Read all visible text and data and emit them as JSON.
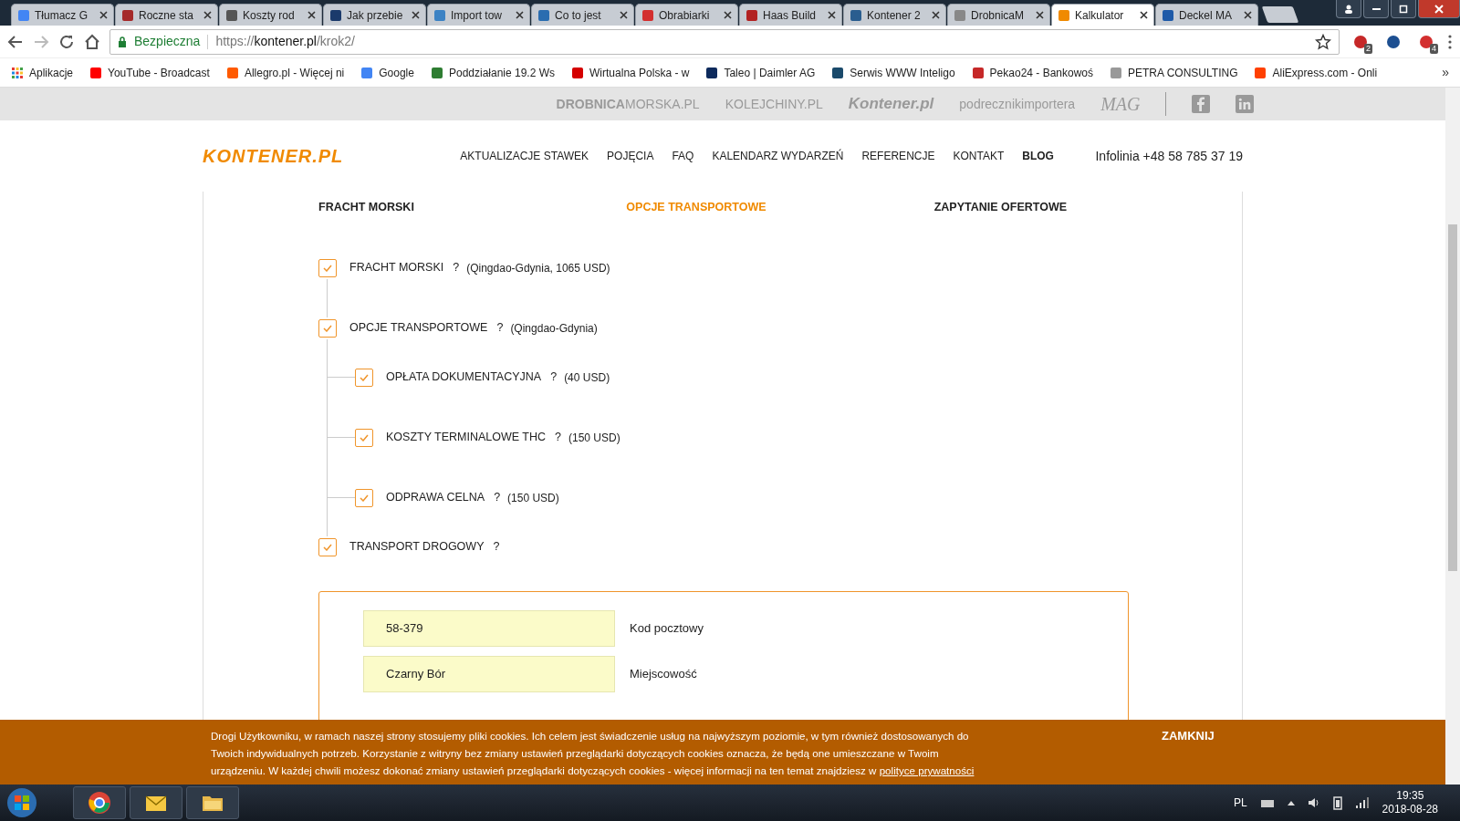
{
  "browser": {
    "tabs": [
      {
        "title": "Tłumacz G",
        "selected": false
      },
      {
        "title": "Roczne sta",
        "selected": false
      },
      {
        "title": "Koszty rod",
        "selected": false
      },
      {
        "title": "Jak przebie",
        "selected": false
      },
      {
        "title": "Import tow",
        "selected": false
      },
      {
        "title": "Co to jest",
        "selected": false
      },
      {
        "title": "Obrabiarki",
        "selected": false
      },
      {
        "title": "Haas Build",
        "selected": false
      },
      {
        "title": "Kontener 2",
        "selected": false
      },
      {
        "title": "DrobnicaM",
        "selected": false
      },
      {
        "title": "Kalkulator",
        "selected": true
      },
      {
        "title": "Deckel MA",
        "selected": false
      }
    ],
    "address": {
      "security": "Bezpieczna",
      "scheme": "https://",
      "host": "kontener.pl",
      "path": "/krok2/"
    },
    "extension_badges": [
      "2",
      "4"
    ],
    "bookmarks": [
      "Aplikacje",
      "YouTube - Broadcast",
      "Allegro.pl - Więcej ni",
      "Google",
      "Poddziałanie 19.2 Ws",
      "Wirtualna Polska - w",
      "Taleo | Daimler AG",
      "Serwis WWW Inteligo",
      "Pekao24 - Bankowoś",
      "PETRA CONSULTING",
      "AliExpress.com - Onli"
    ],
    "bookmarks_more": "»"
  },
  "partner_bar": {
    "logos": [
      "**DROBNICA**MORSKA.PL",
      "KOLEJCHINY.PL",
      "Kontener.pl",
      "podrecznikimportera",
      "MAG"
    ]
  },
  "header": {
    "logo": "KONTENER.PL",
    "nav": [
      {
        "label": "AKTUALIZACJE STAWEK",
        "bold": false
      },
      {
        "label": "POJĘCIA",
        "bold": false
      },
      {
        "label": "FAQ",
        "bold": false
      },
      {
        "label": "KALENDARZ WYDARZEŃ",
        "bold": false
      },
      {
        "label": "REFERENCJE",
        "bold": false
      },
      {
        "label": "KONTAKT",
        "bold": false
      },
      {
        "label": "BLOG",
        "bold": true
      }
    ],
    "hotline": "Infolinia +48 58 785 37 19"
  },
  "steps": [
    {
      "label": "FRACHT MORSKI",
      "selected": false
    },
    {
      "label": "OPCJE TRANSPORTOWE",
      "selected": true
    },
    {
      "label": "ZAPYTANIE OFERTOWE",
      "selected": false
    }
  ],
  "options": [
    {
      "label": "FRACHT MORSKI",
      "help": "?",
      "note": "(Qingdao-Gdynia, 1065 USD)",
      "checked": true
    },
    {
      "label": "OPCJE TRANSPORTOWE",
      "help": "?",
      "note": "(Qingdao-Gdynia)",
      "checked": true,
      "children": [
        {
          "label": "OPŁATA DOKUMENTACYJNA",
          "help": "?",
          "note": "(40 USD)",
          "checked": true
        },
        {
          "label": "KOSZTY TERMINALOWE THC",
          "help": "?",
          "note": "(150 USD)",
          "checked": true
        },
        {
          "label": "ODPRAWA CELNA",
          "help": "?",
          "note": "(150 USD)",
          "checked": true
        }
      ]
    },
    {
      "label": "TRANSPORT DROGOWY",
      "help": "?",
      "checked": true
    }
  ],
  "road_form": {
    "fields": [
      {
        "value": "58-379",
        "label": "Kod pocztowy"
      },
      {
        "value": "Czarny Bór",
        "label": "Miejscowość"
      }
    ]
  },
  "cookie_bar": {
    "text": "Drogi Użytkowniku, w ramach naszej strony stosujemy pliki cookies. Ich celem jest świadczenie usług na najwyższym poziomie, w tym również dostosowanych do Twoich indywidualnych potrzeb. Korzystanie z witryny bez zmiany ustawień przeglądarki dotyczących cookies oznacza, że będą one umieszczane w Twoim urządzeniu. W każdej chwili możesz dokonać zmiany ustawień przeglądarki dotyczących cookies - więcej informacji na ten temat znajdziesz w",
    "link": "polityce prywatności",
    "close": "ZAMKNIJ"
  },
  "taskbar": {
    "language": "PL",
    "time": "19:35",
    "date": "2018-08-28"
  }
}
